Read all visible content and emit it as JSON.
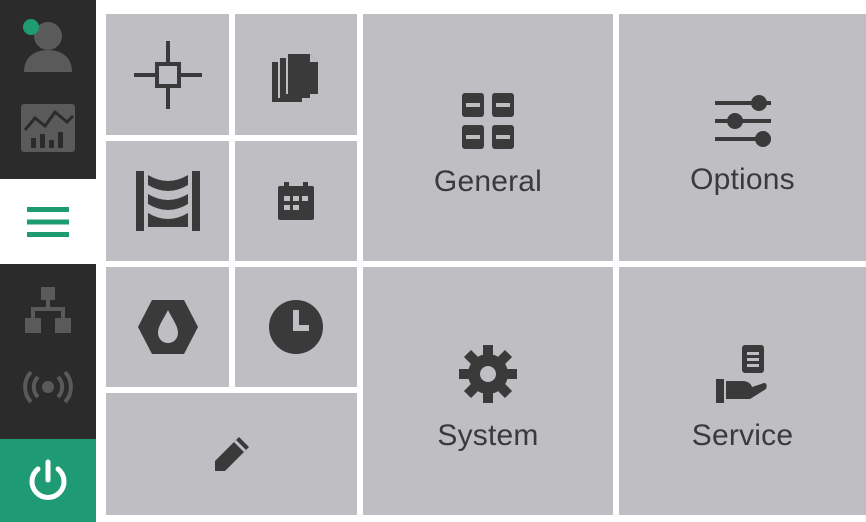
{
  "sidebar": {
    "items": [
      {
        "icon": "user-status-icon",
        "status_color": "#1f9b74"
      },
      {
        "icon": "chart-monitor-icon"
      },
      {
        "icon": "hamburger-menu-icon",
        "accent": "#1f9b74"
      },
      {
        "icon": "network-icon"
      },
      {
        "icon": "broadcast-icon"
      },
      {
        "icon": "power-icon",
        "background": "#1f9b74"
      }
    ]
  },
  "tiles": {
    "small": [
      {
        "icon": "crosshair-icon"
      },
      {
        "icon": "documents-icon"
      },
      {
        "icon": "roller-icon"
      },
      {
        "icon": "calendar-icon"
      },
      {
        "icon": "hex-drop-icon"
      },
      {
        "icon": "clock-icon"
      },
      {
        "icon": "pencil-icon"
      }
    ],
    "large": [
      {
        "icon": "general-grid-icon",
        "label": "General"
      },
      {
        "icon": "sliders-icon",
        "label": "Options"
      },
      {
        "icon": "gear-icon",
        "label": "System"
      },
      {
        "icon": "service-hand-icon",
        "label": "Service"
      }
    ]
  },
  "colors": {
    "sidebar_bg": "#2b2b2b",
    "tile_bg": "#bfbec3",
    "icon_dark": "#3a3a3a",
    "icon_muted": "#5a5a5a",
    "accent": "#1f9b74"
  }
}
